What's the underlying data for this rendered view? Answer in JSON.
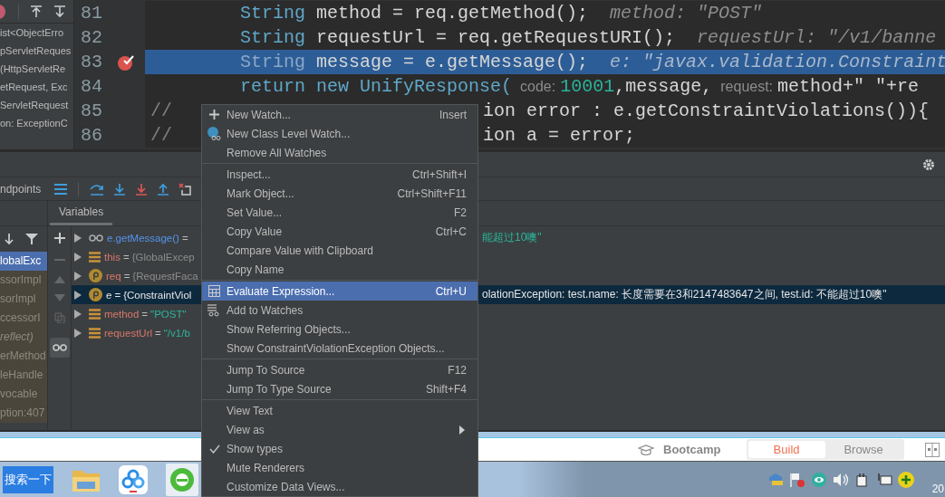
{
  "structure_pane": {
    "lines": [
      "ist<ObjectErro",
      "pServletReques",
      "(HttpServletRe",
      "etRequest, Exc",
      "ServletRequest",
      "on: ExceptionC"
    ]
  },
  "editor": {
    "lines": [
      {
        "number": "81",
        "breakpoint": false,
        "highlighted": false,
        "kind": "code",
        "segments": [
          {
            "text": "String",
            "kind": "keyword"
          },
          {
            "text": "method = req.getMethod();",
            "kind": "plain"
          },
          {
            "text": "method: \"POST\"",
            "kind": "hint"
          }
        ]
      },
      {
        "number": "82",
        "breakpoint": false,
        "highlighted": false,
        "kind": "code",
        "segments": [
          {
            "text": "String",
            "kind": "keyword"
          },
          {
            "text": "requestUrl = req.getRequestURI();",
            "kind": "plain"
          },
          {
            "text": "requestUrl: \"/v1/banne",
            "kind": "hint"
          }
        ]
      },
      {
        "number": "83",
        "breakpoint": true,
        "highlighted": true,
        "kind": "code",
        "segments": [
          {
            "text": "String",
            "kind": "keyword"
          },
          {
            "text": "message = e.getMessage();",
            "kind": "plain"
          },
          {
            "text": "e: \"javax.validation.Constraint",
            "kind": "hint"
          }
        ]
      },
      {
        "number": "84",
        "breakpoint": false,
        "highlighted": false,
        "kind": "code",
        "segments": [
          {
            "text": "return new UnifyResponse(",
            "kind": "keyword"
          },
          {
            "text": "code:",
            "kind": "param"
          },
          {
            "text": "10001",
            "kind": "number"
          },
          {
            "text": ",message,",
            "kind": "attached"
          },
          {
            "text": "request:",
            "kind": "param"
          },
          {
            "text": "method+\" \"+re",
            "kind": "plain"
          }
        ]
      },
      {
        "number": "85",
        "breakpoint": false,
        "highlighted": false,
        "kind": "split",
        "before": "//",
        "after": "ion error : e.getConstraintViolations()){"
      },
      {
        "number": "86",
        "breakpoint": false,
        "highlighted": false,
        "kind": "split",
        "before": "//",
        "after": "ion a = error;"
      }
    ]
  },
  "debugger": {
    "toolbar_label": "ndpoints",
    "tabs": [
      {
        "label": "Variables",
        "selected": true
      }
    ],
    "frames": [
      {
        "label": "lobalExc",
        "selected": true,
        "kind": "frame"
      },
      {
        "label": "ssorImpl",
        "selected": false,
        "kind": "frame"
      },
      {
        "label": "sorImpl",
        "selected": false,
        "kind": "frame"
      },
      {
        "label": "ccessorI",
        "selected": false,
        "kind": "frame"
      },
      {
        "label": "reflect)",
        "selected": false,
        "kind": "package"
      },
      {
        "label": "erMethod",
        "selected": false,
        "kind": "frame"
      },
      {
        "label": "leHandle",
        "selected": false,
        "kind": "frame"
      },
      {
        "label": "vocable",
        "selected": false,
        "kind": "frame"
      },
      {
        "label": "ption:407",
        "selected": false,
        "kind": "frame"
      }
    ],
    "variables": [
      {
        "kind": "watch",
        "name": "e.getMessage()",
        "equals": "=",
        "color": "#2ab59c",
        "tail": "能超过10噢\"",
        "selected": false,
        "expanded": false
      },
      {
        "kind": "field",
        "name": "this",
        "equals": "=",
        "value": "{GlobalExcep",
        "color": "#8c8c8c",
        "selected": false,
        "expanded": false
      },
      {
        "kind": "param",
        "name": "req",
        "equals": "=",
        "value": "{RequestFaca",
        "color": "#8c8c8c",
        "selected": false,
        "expanded": false
      },
      {
        "kind": "param",
        "name": "e",
        "equals": "=",
        "value": "{ConstraintViol",
        "color": "#e6e6e6",
        "tail": "olationException: test.name: 长度需要在3和2147483647之间, test.id: 不能超过10噢\"",
        "selected": true,
        "expanded": false
      },
      {
        "kind": "field",
        "name": "method",
        "equals": "=",
        "value": "\"POST\"",
        "color": "#2ab59c",
        "selected": false,
        "expanded": false
      },
      {
        "kind": "field",
        "name": "requestUrl",
        "equals": "=",
        "value": "\"/v1/b",
        "color": "#2ab59c",
        "selected": false,
        "expanded": false
      }
    ]
  },
  "context_menu": {
    "groups": [
      {
        "items": [
          {
            "label": "New Watch...",
            "shortcut": "Insert",
            "selected": false,
            "checked": false,
            "submenu": false
          },
          {
            "label": "New Class Level Watch...",
            "selected": false,
            "checked": false,
            "submenu": false
          },
          {
            "label": "Remove All Watches",
            "selected": false,
            "checked": false,
            "submenu": false
          }
        ]
      },
      {
        "items": [
          {
            "label": "Inspect...",
            "shortcut": "Ctrl+Shift+I",
            "selected": false,
            "checked": false,
            "submenu": false
          },
          {
            "label": "Mark Object...",
            "shortcut": "Ctrl+Shift+F11",
            "selected": false,
            "checked": false,
            "submenu": false
          },
          {
            "label": "Set Value...",
            "shortcut": "F2",
            "selected": false,
            "checked": false,
            "submenu": false
          },
          {
            "label": "Copy Value",
            "shortcut": "Ctrl+C",
            "selected": false,
            "checked": false,
            "submenu": false
          },
          {
            "label": "Compare Value with Clipboard",
            "selected": false,
            "checked": false,
            "submenu": false
          },
          {
            "label": "Copy Name",
            "selected": false,
            "checked": false,
            "submenu": false
          }
        ]
      },
      {
        "items": [
          {
            "label": "Evaluate Expression...",
            "shortcut": "Ctrl+U",
            "selected": true,
            "checked": false,
            "submenu": false
          },
          {
            "label": "Add to Watches",
            "selected": false,
            "checked": false,
            "submenu": false
          },
          {
            "label": "Show Referring Objects...",
            "selected": false,
            "checked": false,
            "submenu": false
          },
          {
            "label": "Show ConstraintViolationException Objects...",
            "selected": false,
            "checked": false,
            "submenu": false
          }
        ]
      },
      {
        "items": [
          {
            "label": "Jump To Source",
            "shortcut": "F12",
            "selected": false,
            "checked": false,
            "submenu": false
          },
          {
            "label": "Jump To Type Source",
            "shortcut": "Shift+F4",
            "selected": false,
            "checked": false,
            "submenu": false
          }
        ]
      },
      {
        "items": [
          {
            "label": "View Text",
            "selected": false,
            "checked": false,
            "submenu": false
          },
          {
            "label": "View as",
            "selected": false,
            "checked": false,
            "submenu": true
          },
          {
            "label": "Show types",
            "selected": false,
            "checked": true,
            "submenu": false
          },
          {
            "label": "Mute Renderers",
            "selected": false,
            "checked": false,
            "submenu": false
          },
          {
            "label": "Customize Data Views...",
            "selected": false,
            "checked": false,
            "submenu": false
          }
        ]
      }
    ]
  },
  "bottom_bar": {
    "label": "Bootcamp",
    "toggle": [
      {
        "label": "Build",
        "selected": true
      },
      {
        "label": "Browse",
        "selected": false
      }
    ]
  },
  "taskbar": {
    "search_button": "搜索一下",
    "clock": "20"
  }
}
